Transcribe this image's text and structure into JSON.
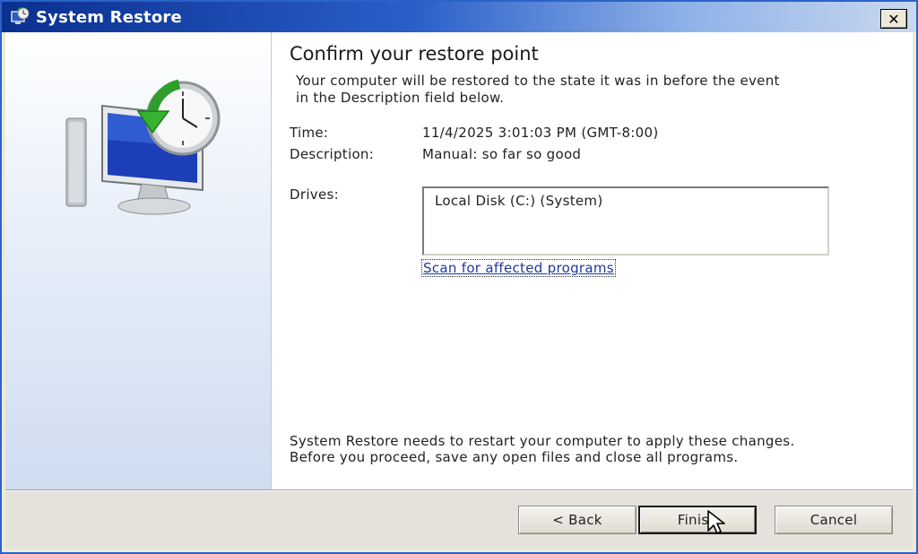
{
  "window": {
    "title": "System Restore",
    "close_label": "✕"
  },
  "main": {
    "heading": "Confirm your restore point",
    "intro_line1": "Your computer will be restored to the state it was in before the event",
    "intro_line2": "in the Description field below.",
    "time_label": "Time:",
    "time_value": "11/4/2025 3:01:03 PM (GMT-8:00)",
    "description_label": "Description:",
    "description_value": "Manual: so far so good",
    "drives_label": "Drives:",
    "drives": [
      "Local Disk (C:) (System)"
    ],
    "scan_link": "Scan for affected programs",
    "footer_line1": "System Restore needs to restart your computer to apply these changes.",
    "footer_line2": "Before you proceed, save any open files and close all programs."
  },
  "buttons": {
    "back": "< Back",
    "finish": "Finish",
    "cancel": "Cancel"
  },
  "icons": {
    "title": "system-restore-icon",
    "art": "monitor-clock-restore-icon",
    "cursor": "mouse-pointer-icon"
  }
}
